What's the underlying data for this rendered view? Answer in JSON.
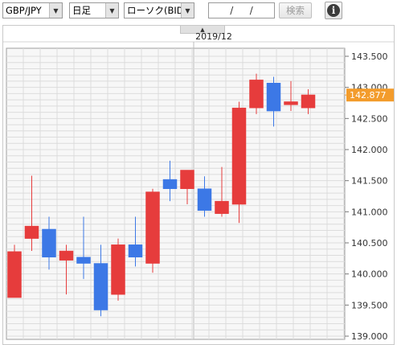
{
  "toolbar": {
    "pair": "GBP/JPY",
    "period": "日足",
    "chart_kind": "ローソク(BID)",
    "date_separators": [
      "/",
      "/"
    ],
    "search_label": "検索",
    "info_icon": "info-icon",
    "dropdown_icon": "chevron-down-icon",
    "collapse_icon": "chevron-up-icon"
  },
  "colors": {
    "bullish": "#e63c3c",
    "bearish": "#3c78e6",
    "current_price_bg": "#f39c2c",
    "grid": "#dcdcdc",
    "panel_bg": "#f7f7f7"
  },
  "chart_data": {
    "type": "candlestick",
    "month_label": "2019/12",
    "current_price": "142.877",
    "y_ticks": [
      "143.500",
      "143.000",
      "142.500",
      "142.000",
      "141.500",
      "141.000",
      "140.500",
      "140.000",
      "139.500",
      "139.000"
    ],
    "ylim": [
      139.0,
      143.5
    ],
    "candles": [
      {
        "o": 139.62,
        "h": 140.47,
        "l": 139.62,
        "c": 140.36
      },
      {
        "o": 140.57,
        "h": 141.58,
        "l": 140.37,
        "c": 140.77
      },
      {
        "o": 140.72,
        "h": 140.92,
        "l": 140.07,
        "c": 140.27
      },
      {
        "o": 140.22,
        "h": 140.47,
        "l": 139.67,
        "c": 140.37
      },
      {
        "o": 140.27,
        "h": 140.92,
        "l": 139.92,
        "c": 140.17
      },
      {
        "o": 140.17,
        "h": 140.47,
        "l": 139.32,
        "c": 139.42
      },
      {
        "o": 139.67,
        "h": 140.57,
        "l": 139.57,
        "c": 140.47
      },
      {
        "o": 140.47,
        "h": 140.92,
        "l": 140.12,
        "c": 140.27
      },
      {
        "o": 140.17,
        "h": 141.37,
        "l": 140.02,
        "c": 141.32
      },
      {
        "o": 141.52,
        "h": 141.82,
        "l": 141.17,
        "c": 141.37
      },
      {
        "o": 141.37,
        "h": 141.67,
        "l": 141.12,
        "c": 141.67
      },
      {
        "o": 141.37,
        "h": 141.57,
        "l": 140.92,
        "c": 141.02
      },
      {
        "o": 140.97,
        "h": 141.72,
        "l": 140.92,
        "c": 141.17
      },
      {
        "o": 141.12,
        "h": 142.77,
        "l": 140.82,
        "c": 142.67
      },
      {
        "o": 142.67,
        "h": 143.22,
        "l": 142.57,
        "c": 143.12
      },
      {
        "o": 143.07,
        "h": 143.17,
        "l": 142.37,
        "c": 142.62
      },
      {
        "o": 142.72,
        "h": 143.1,
        "l": 142.62,
        "c": 142.77
      },
      {
        "o": 142.67,
        "h": 142.97,
        "l": 142.57,
        "c": 142.88
      }
    ]
  }
}
